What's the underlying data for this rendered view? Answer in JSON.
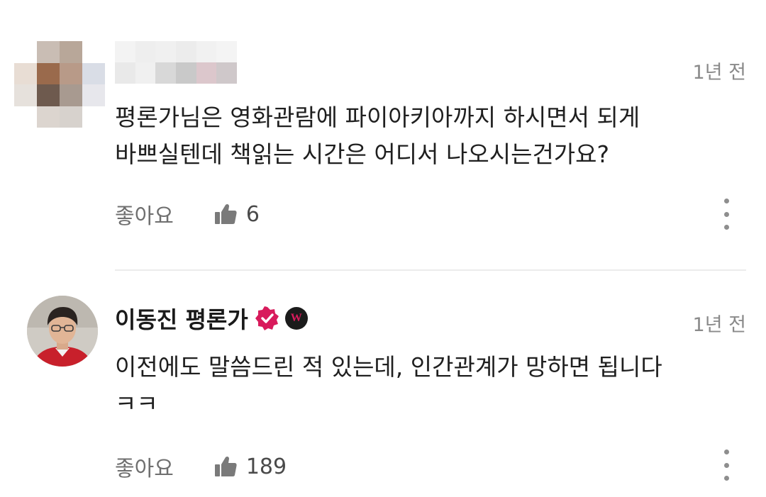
{
  "comments": [
    {
      "author": "",
      "time": "1년 전",
      "body_lines": [
        "평론가님은 영화관람에 파이아키아까지 하시면서 되게",
        "바쁘실텐데 책읽는 시간은 어디서 나오시는건가요?"
      ],
      "like_label": "좋아요",
      "like_count": "6"
    },
    {
      "author": "이동진 평론가",
      "time": "1년 전",
      "body_lines": [
        "이전에도 말씀드린 적 있는데, 인간관계가 망하면 됩니다",
        "ㅋㅋ"
      ],
      "like_label": "좋아요",
      "like_count": "189"
    }
  ],
  "badges": {
    "verified_icon": "verified-check-icon",
    "w_badge_text": "W"
  },
  "colors": {
    "accent": "#d81b5c",
    "muted": "#8a8a8a"
  }
}
